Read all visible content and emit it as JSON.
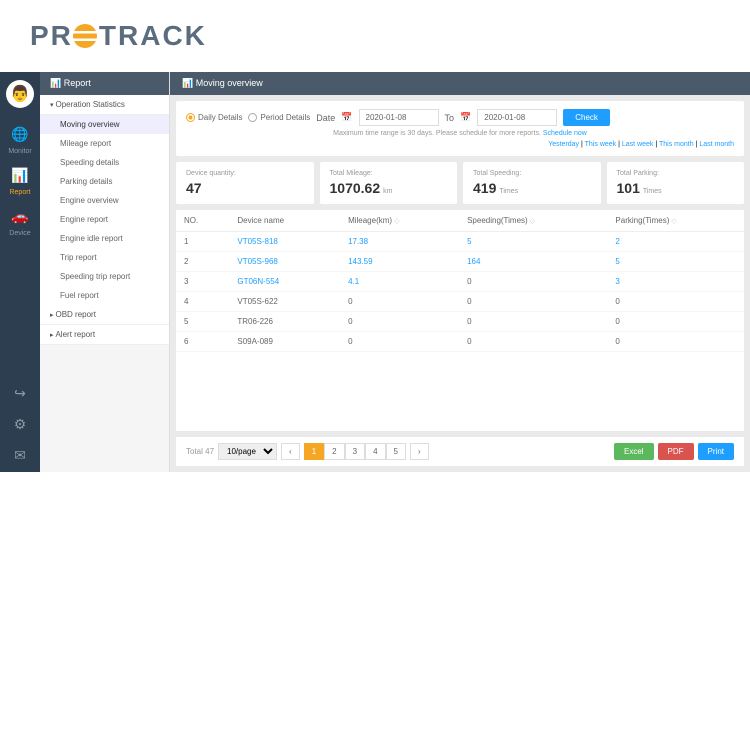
{
  "logo": "PR   TRACK",
  "nav": {
    "items": [
      {
        "icon": "🌐",
        "label": "Monitor"
      },
      {
        "icon": "📊",
        "label": "Report"
      },
      {
        "icon": "🚗",
        "label": "Device"
      }
    ],
    "utilIcons": [
      "↪",
      "⚙",
      "✉"
    ]
  },
  "sidebar": {
    "header": "📊 Report",
    "groups": [
      {
        "label": "Operation Statistics",
        "expanded": true,
        "children": [
          "Moving overview",
          "Mileage report",
          "Speeding details",
          "Parking details",
          "Engine overview",
          "Engine report",
          "Engine idle report",
          "Trip report",
          "Speeding trip report",
          "Fuel report"
        ]
      },
      {
        "label": "OBD report",
        "expanded": false
      },
      {
        "label": "Alert report",
        "expanded": false
      }
    ],
    "activeChild": "Moving overview"
  },
  "main": {
    "header": "📊 Moving overview",
    "filter": {
      "daily": "Daily Details",
      "period": "Period Details",
      "dateLabel": "Date",
      "from": "2020-01-08",
      "toLabel": "To",
      "to": "2020-01-08",
      "check": "Check",
      "hint": "Maximum time range is 30 days. Please schedule for more reports.",
      "scheduleLink": "Schedule now",
      "quick": [
        "Yesterday",
        "This week",
        "Last week",
        "This month",
        "Last month"
      ]
    },
    "stats": [
      {
        "label": "Device quantity:",
        "value": "47",
        "unit": ""
      },
      {
        "label": "Total Mileage:",
        "value": "1070.62",
        "unit": "km"
      },
      {
        "label": "Total Speeding:",
        "value": "419",
        "unit": "Times"
      },
      {
        "label": "Total Parking:",
        "value": "101",
        "unit": "Times"
      }
    ],
    "table": {
      "headers": [
        "NO.",
        "Device name",
        "Mileage(km)",
        "Speeding(Times)",
        "Parking(Times)"
      ],
      "rows": [
        {
          "no": "1",
          "name": "VT05S-818",
          "mileage": "17.38",
          "speeding": "5",
          "parking": "2",
          "link": true
        },
        {
          "no": "2",
          "name": "VT05S-968",
          "mileage": "143.59",
          "speeding": "164",
          "parking": "5",
          "link": true
        },
        {
          "no": "3",
          "name": "GT06N-554",
          "mileage": "4.1",
          "speeding": "0",
          "parking": "3",
          "link": true
        },
        {
          "no": "4",
          "name": "VT05S-622",
          "mileage": "0",
          "speeding": "0",
          "parking": "0",
          "link": false
        },
        {
          "no": "5",
          "name": "TR06-226",
          "mileage": "0",
          "speeding": "0",
          "parking": "0",
          "link": false
        },
        {
          "no": "6",
          "name": "S09A-089",
          "mileage": "0",
          "speeding": "0",
          "parking": "0",
          "link": false
        }
      ]
    },
    "footer": {
      "total": "Total 47",
      "perPage": "10/page",
      "pages": [
        "1",
        "2",
        "3",
        "4",
        "5"
      ],
      "excel": "Excel",
      "pdf": "PDF",
      "print": "Print"
    }
  }
}
